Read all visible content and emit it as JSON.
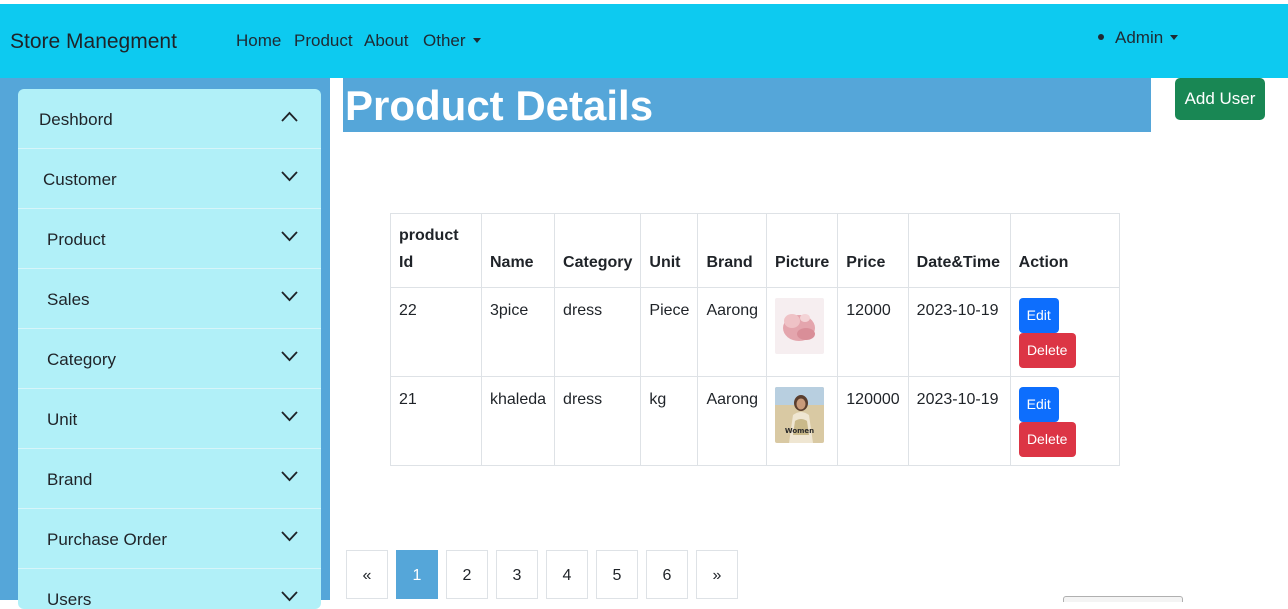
{
  "navbar": {
    "brand": "Store Manegment",
    "links": [
      "Home",
      "Product",
      "About",
      "Other"
    ],
    "user": "Admin",
    "color": "#0dcaf0"
  },
  "sidebar": {
    "items": [
      {
        "label": "Deshbord",
        "icon": "chevron-up-icon"
      },
      {
        "label": "Customer",
        "icon": "chevron-down-icon"
      },
      {
        "label": "Product",
        "icon": "chevron-down-icon"
      },
      {
        "label": "Sales",
        "icon": "chevron-down-icon"
      },
      {
        "label": "Category",
        "icon": "chevron-down-icon"
      },
      {
        "label": "Unit",
        "icon": "chevron-down-icon"
      },
      {
        "label": "Brand",
        "icon": "chevron-down-icon"
      },
      {
        "label": "Purchase Order",
        "icon": "chevron-down-icon"
      },
      {
        "label": "Users",
        "icon": "chevron-down-icon"
      }
    ]
  },
  "main": {
    "title": "Product Details",
    "add_user_label": "Add User",
    "table": {
      "headers": {
        "id_line1": "product",
        "id_line2": "Id",
        "name": "Name",
        "category": "Category",
        "unit": "Unit",
        "brand": "Brand",
        "picture": "Picture",
        "price": "Price",
        "datetime": "Date&Time",
        "action": "Action"
      },
      "rows": [
        {
          "id": "22",
          "name": "3pice",
          "category": "dress",
          "unit": "Piece",
          "brand": "Aarong",
          "picture": "product-photo-pink",
          "price": "12000",
          "datetime": "2023-10-19",
          "edit": "Edit",
          "delete": "Delete"
        },
        {
          "id": "21",
          "name": "khaleda",
          "category": "dress",
          "unit": "kg",
          "brand": "Aarong",
          "picture": "product-photo-women",
          "picture_caption": "Women",
          "price": "120000",
          "datetime": "2023-10-19",
          "edit": "Edit",
          "delete": "Delete"
        }
      ]
    },
    "pagination": {
      "prev": "«",
      "pages": [
        "1",
        "2",
        "3",
        "4",
        "5",
        "6"
      ],
      "next": "»",
      "active": "1"
    }
  },
  "colors": {
    "sidebar_bg": "#55a6d9",
    "sidebar_panel": "#b1f0f8",
    "add_user": "#198754",
    "edit": "#0d6efd",
    "delete": "#dc3545"
  }
}
